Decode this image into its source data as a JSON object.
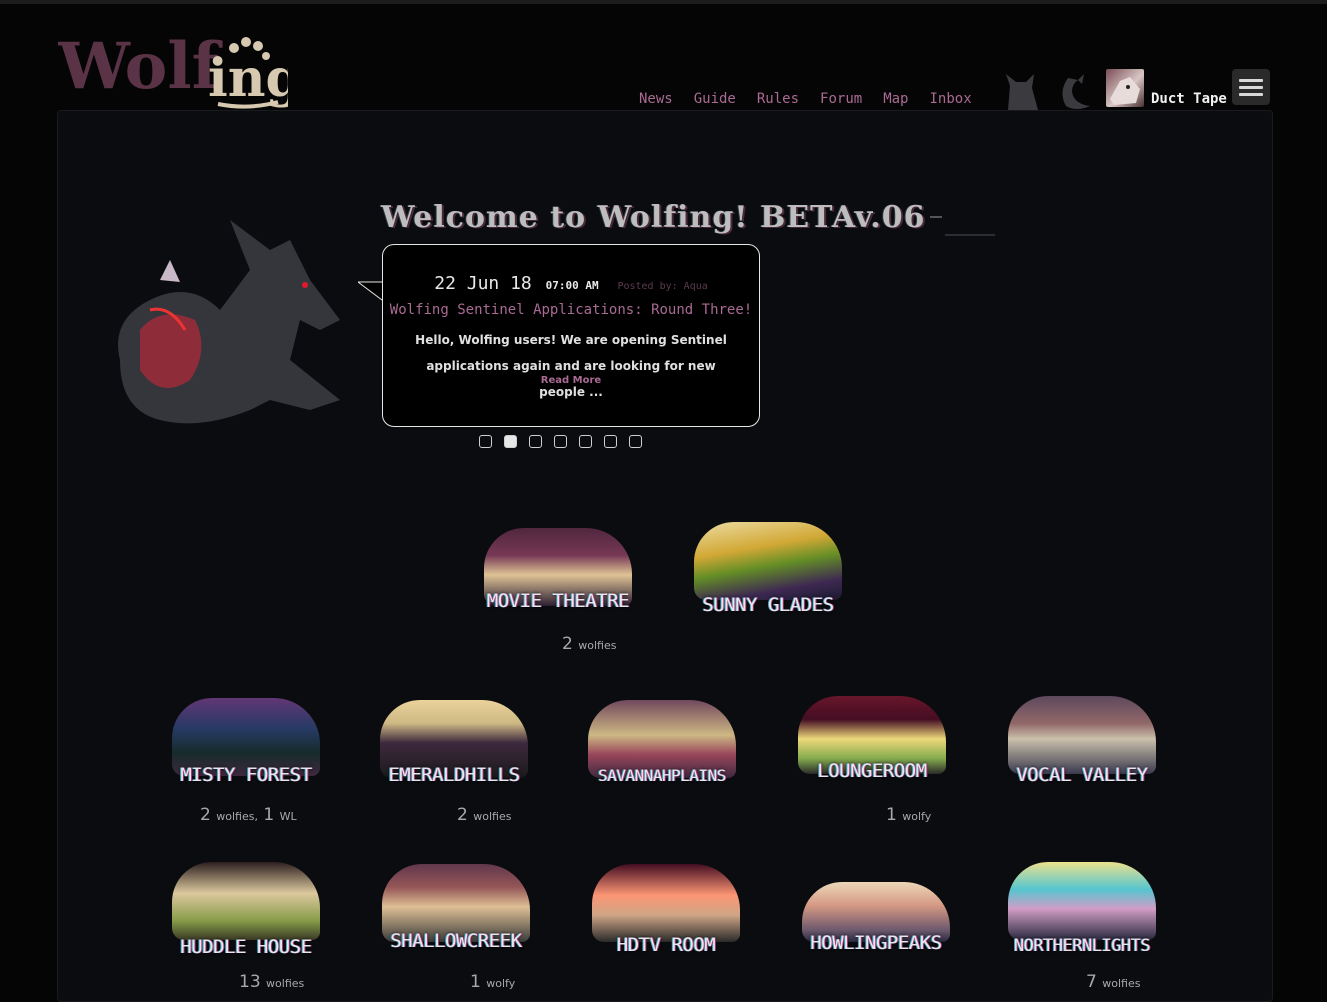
{
  "site": {
    "logo_text": "Wolfing"
  },
  "nav": [
    "News",
    "Guide",
    "Rules",
    "Forum",
    "Map",
    "Inbox"
  ],
  "user": {
    "name": "Duct Tape"
  },
  "colors": {
    "accent": "#a96a93",
    "background": "#050505",
    "panel": "#0b0c10"
  },
  "welcome": {
    "title": "Welcome to Wolfing! BETAv.06"
  },
  "news": {
    "date": "22 Jun 18",
    "time": "07:00 AM",
    "posted_by": "Posted by: Aqua",
    "title": "Wolfing Sentinel Applications: Round Three!",
    "excerpt": "Hello, Wolfing users! We are opening Sentinel applications again and are looking for new people ...",
    "read_more": "Read More",
    "slides": 7,
    "active_slide": 2
  },
  "rooms": [
    {
      "name": "MOVIE THEATRE",
      "count": "2",
      "count_unit": "wolfies",
      "wl": "",
      "wl_unit": ""
    },
    {
      "name": "SUNNY GLADES",
      "count": "",
      "count_unit": "",
      "wl": "",
      "wl_unit": ""
    },
    {
      "name": "MISTY FOREST",
      "count": "2",
      "count_unit": "wolfies,",
      "wl": "1",
      "wl_unit": "WL"
    },
    {
      "name": "EMERALDHILLS",
      "count": "2",
      "count_unit": "wolfies",
      "wl": "",
      "wl_unit": ""
    },
    {
      "name": "SAVANNAHPLAINS",
      "count": "",
      "count_unit": "",
      "wl": "",
      "wl_unit": ""
    },
    {
      "name": "LOUNGEROOM",
      "count": "1",
      "count_unit": "wolfy",
      "wl": "",
      "wl_unit": ""
    },
    {
      "name": "VOCAL VALLEY",
      "count": "",
      "count_unit": "",
      "wl": "",
      "wl_unit": ""
    },
    {
      "name": "HUDDLE HOUSE",
      "count": "13",
      "count_unit": "wolfies",
      "wl": "",
      "wl_unit": ""
    },
    {
      "name": "SHALLOWCREEK",
      "count": "1",
      "count_unit": "wolfy",
      "wl": "",
      "wl_unit": ""
    },
    {
      "name": "HDTV ROOM",
      "count": "",
      "count_unit": "",
      "wl": "",
      "wl_unit": ""
    },
    {
      "name": "HOWLINGPEAKS",
      "count": "",
      "count_unit": "",
      "wl": "",
      "wl_unit": ""
    },
    {
      "name": "NORTHERNLIGHTS",
      "count": "7",
      "count_unit": "wolfies",
      "wl": "",
      "wl_unit": ""
    }
  ]
}
